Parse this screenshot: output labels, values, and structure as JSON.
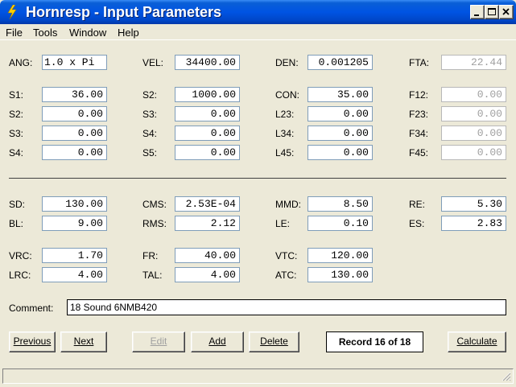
{
  "window": {
    "title": "Hornresp - Input Parameters"
  },
  "menu": [
    {
      "label": "File"
    },
    {
      "label": "Tools"
    },
    {
      "label": "Window"
    },
    {
      "label": "Help"
    }
  ],
  "params": {
    "ANG": {
      "label": "ANG:",
      "value": "1.0 x Pi"
    },
    "VEL": {
      "label": "VEL:",
      "value": "34400.00"
    },
    "DEN": {
      "label": "DEN:",
      "value": "0.001205"
    },
    "FTA": {
      "label": "FTA:",
      "value": "22.44"
    },
    "S1_a": {
      "label": "S1:",
      "value": "36.00"
    },
    "S2_a": {
      "label": "S2:",
      "value": "0.00"
    },
    "S3_a": {
      "label": "S3:",
      "value": "0.00"
    },
    "S4_a": {
      "label": "S4:",
      "value": "0.00"
    },
    "S2_b": {
      "label": "S2:",
      "value": "1000.00"
    },
    "S3_b": {
      "label": "S3:",
      "value": "0.00"
    },
    "S4_b": {
      "label": "S4:",
      "value": "0.00"
    },
    "S5_b": {
      "label": "S5:",
      "value": "0.00"
    },
    "CON": {
      "label": "CON:",
      "value": "35.00"
    },
    "L23": {
      "label": "L23:",
      "value": "0.00"
    },
    "L34": {
      "label": "L34:",
      "value": "0.00"
    },
    "L45": {
      "label": "L45:",
      "value": "0.00"
    },
    "F12": {
      "label": "F12:",
      "value": "0.00"
    },
    "F23": {
      "label": "F23:",
      "value": "0.00"
    },
    "F34": {
      "label": "F34:",
      "value": "0.00"
    },
    "F45": {
      "label": "F45:",
      "value": "0.00"
    },
    "SD": {
      "label": "SD:",
      "value": "130.00"
    },
    "BL": {
      "label": "BL:",
      "value": "9.00"
    },
    "CMS": {
      "label": "CMS:",
      "value": "2.53E-04"
    },
    "RMS": {
      "label": "RMS:",
      "value": "2.12"
    },
    "MMD": {
      "label": "MMD:",
      "value": "8.50"
    },
    "LE": {
      "label": "LE:",
      "value": "0.10"
    },
    "RE": {
      "label": "RE:",
      "value": "5.30"
    },
    "ES": {
      "label": "ES:",
      "value": "2.83"
    },
    "VRC": {
      "label": "VRC:",
      "value": "1.70"
    },
    "LRC": {
      "label": "LRC:",
      "value": "4.00"
    },
    "FR": {
      "label": "FR:",
      "value": "40.00"
    },
    "TAL": {
      "label": "TAL:",
      "value": "4.00"
    },
    "VTC": {
      "label": "VTC:",
      "value": "120.00"
    },
    "ATC": {
      "label": "ATC:",
      "value": "130.00"
    }
  },
  "comment": {
    "label": "Comment:",
    "value": "18 Sound 6NMB420"
  },
  "buttons": {
    "previous": "Previous",
    "next": "Next",
    "edit": "Edit",
    "add": "Add",
    "delete": "Delete",
    "calculate": "Calculate"
  },
  "record": "Record 16 of 18"
}
